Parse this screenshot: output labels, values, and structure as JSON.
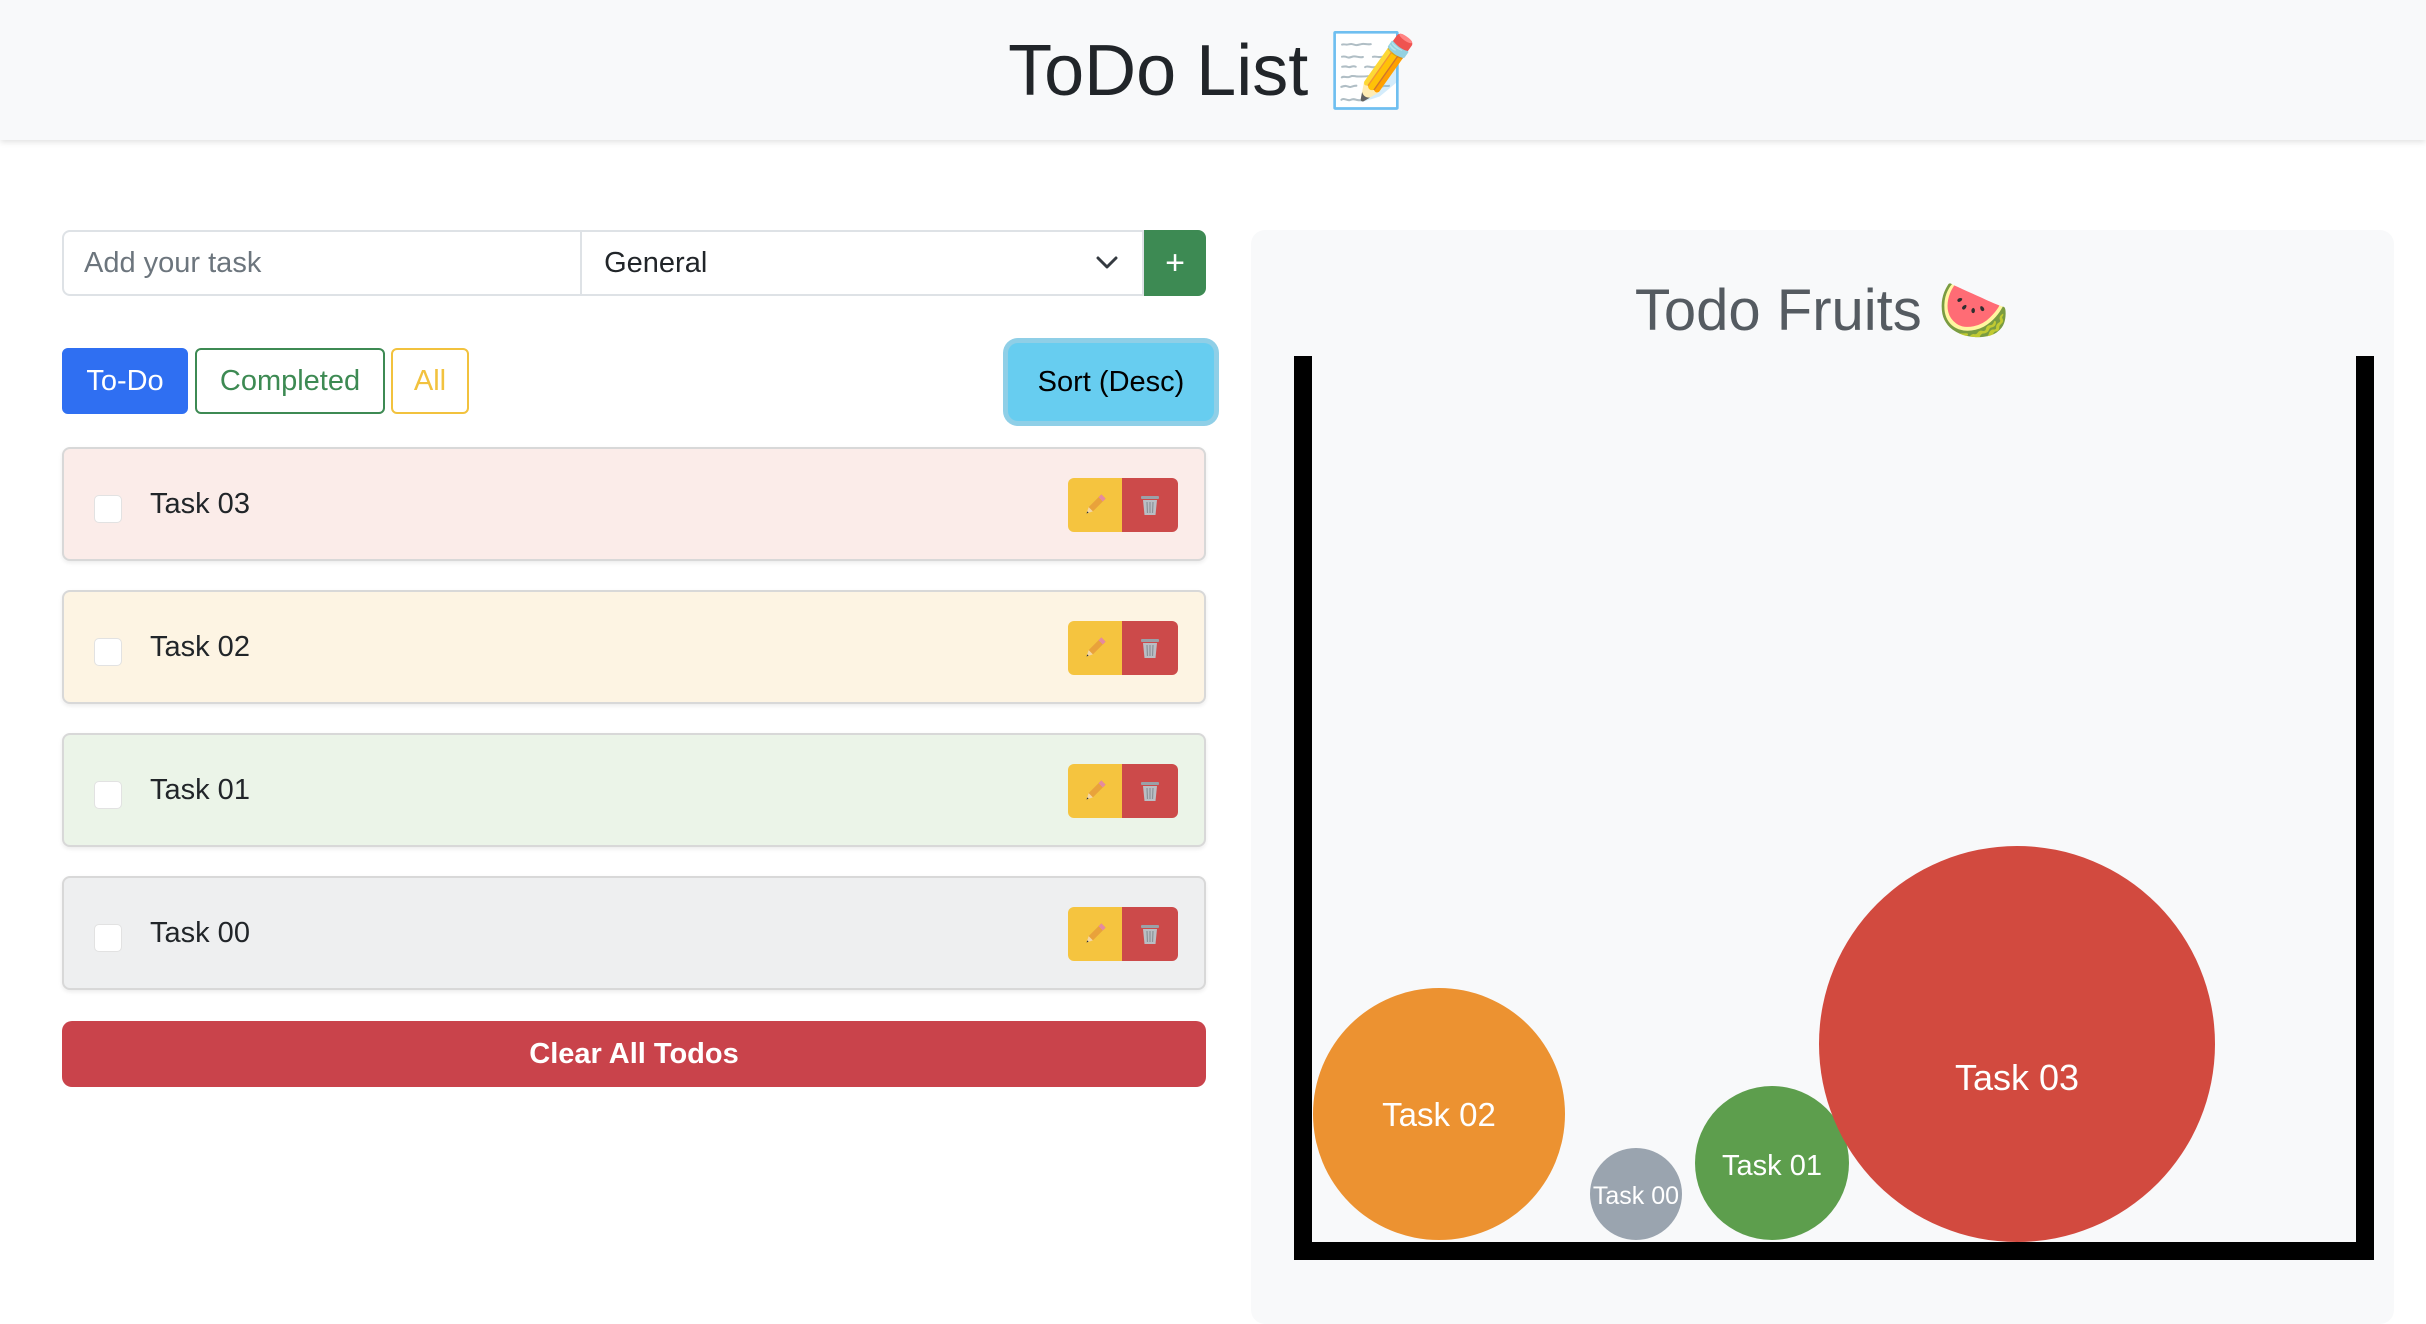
{
  "header": {
    "title": "ToDo List",
    "emoji": "📝"
  },
  "add_form": {
    "input_placeholder": "Add your task",
    "input_value": "",
    "category_selected": "General",
    "add_label": "+"
  },
  "filters": {
    "todo": "To-Do",
    "completed": "Completed",
    "all": "All",
    "active": "To-Do"
  },
  "sort_label": "Sort (Desc)",
  "tasks": [
    {
      "label": "Task 03",
      "checked": false,
      "bg": "#fbece9"
    },
    {
      "label": "Task 02",
      "checked": false,
      "bg": "#fdf4e3"
    },
    {
      "label": "Task 01",
      "checked": false,
      "bg": "#ebf4e8"
    },
    {
      "label": "Task 00",
      "checked": false,
      "bg": "#eeeff0"
    }
  ],
  "clear_label": "Clear All Todos",
  "fruits": {
    "title": "Todo Fruits",
    "emoji": "🍉",
    "balls": [
      {
        "label": "Task 02",
        "color": "#ec9231"
      },
      {
        "label": "Task 00",
        "color": "#9aa4af"
      },
      {
        "label": "Task 01",
        "color": "#5d9e4d"
      },
      {
        "label": "Task 03",
        "color": "#d24a3f"
      }
    ]
  },
  "colors": {
    "primary": "#2f6ff2",
    "success": "#3d8a53",
    "warning": "#f2c23e",
    "info": "#67cdf0",
    "danger": "#c9434b"
  }
}
